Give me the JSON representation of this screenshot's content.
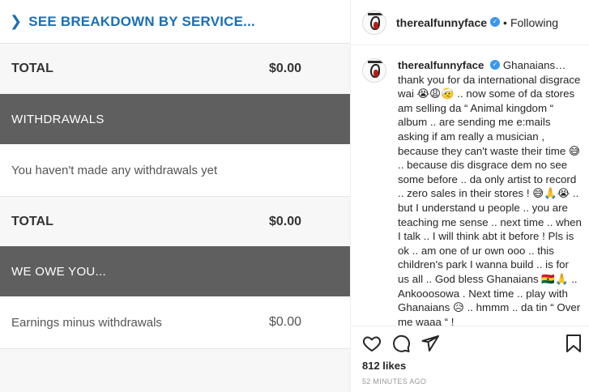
{
  "post_image": {
    "breakdown_link": "SEE BREAKDOWN BY SERVICE...",
    "total_label_1": "TOTAL",
    "total_value_1": "$0.00",
    "withdrawals_header": "WITHDRAWALS",
    "no_withdrawals_text": "You haven't made any withdrawals yet",
    "total_label_2": "TOTAL",
    "total_value_2": "$0.00",
    "we_owe_header": "WE OWE YOU...",
    "earnings_label": "Earnings minus withdrawals",
    "earnings_value": "$0.00"
  },
  "header": {
    "username": "therealfunnyface",
    "separator": "•",
    "follow_status": "Following"
  },
  "caption": {
    "username": "therealfunnyface",
    "text": "Ghanaians… thank you for da international disgrace wai 😭😩🤕 .. now some of da stores am selling da “ Animal kingdom “ album .. are sending me e:mails asking if am really a musician , because they can't waste their time 😅 .. because dis disgrace dem no see some before .. da only artist to record .. zero sales in their stores ! 😅🙏😭 .. but I understand u people .. you are teaching me sense .. next time .. when I talk .. I will think abt it before ! Pls is ok .. am one of ur own ooo .. this children's park I wanna build .. is for us all .. God bless Ghanaians 🇬🇭🙏 .. Ankooosowa . Next time .. play with Ghanaians 😥 .. hmmm .. da tin “ Over me waaa “ !"
  },
  "icons": {
    "like": "heart-icon",
    "comment": "comment-icon",
    "share": "share-icon",
    "save": "bookmark-icon",
    "verified": "verified-badge-icon"
  },
  "likes": "812 likes",
  "timestamp": "52 MINUTES AGO",
  "colors": {
    "link_blue": "#1a6fb5",
    "band_gray": "#5f5f5f",
    "verified_blue": "#3897f0"
  }
}
